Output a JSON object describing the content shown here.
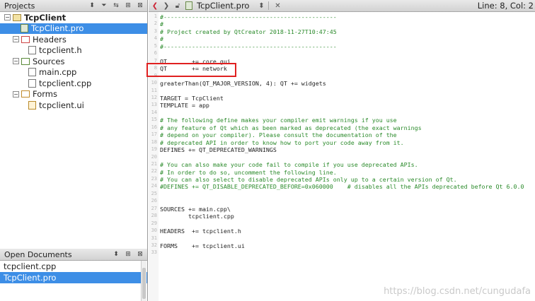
{
  "projects_panel": {
    "title": "Projects",
    "tree": [
      {
        "label": "TcpClient",
        "level": 0,
        "kind": "project",
        "expanded": true,
        "bold": true
      },
      {
        "label": "TcpClient.pro",
        "level": 1,
        "kind": "pro",
        "selected": true
      },
      {
        "label": "Headers",
        "level": 1,
        "kind": "folder-h",
        "expanded": true
      },
      {
        "label": "tcpclient.h",
        "level": 2,
        "kind": "h"
      },
      {
        "label": "Sources",
        "level": 1,
        "kind": "folder-s",
        "expanded": true
      },
      {
        "label": "main.cpp",
        "level": 2,
        "kind": "cpp"
      },
      {
        "label": "tcpclient.cpp",
        "level": 2,
        "kind": "cpp"
      },
      {
        "label": "Forms",
        "level": 1,
        "kind": "folder-f",
        "expanded": true
      },
      {
        "label": "tcpclient.ui",
        "level": 2,
        "kind": "ui"
      }
    ]
  },
  "open_documents": {
    "title": "Open Documents",
    "items": [
      {
        "label": "tcpclient.cpp",
        "selected": false
      },
      {
        "label": "TcpClient.pro",
        "selected": true
      }
    ]
  },
  "editor": {
    "filename": "TcpClient.pro",
    "line_info": "Line: 8, Col: 2",
    "lines": [
      {
        "n": "1",
        "text": "#-------------------------------------------------",
        "cls": "cm"
      },
      {
        "n": "2",
        "text": "#",
        "cls": "cm"
      },
      {
        "n": "3",
        "text": "# Project created by QtCreator 2018-11-27T10:47:45",
        "cls": "cm"
      },
      {
        "n": "4",
        "text": "#",
        "cls": "cm"
      },
      {
        "n": "5",
        "text": "#-------------------------------------------------",
        "cls": "cm"
      },
      {
        "n": "6",
        "text": "",
        "cls": "tx"
      },
      {
        "n": "7",
        "text": "QT       += core gui",
        "cls": "tx"
      },
      {
        "n": "8",
        "text": "QT       += network",
        "cls": "tx"
      },
      {
        "n": "9",
        "text": "",
        "cls": "tx"
      },
      {
        "n": "10",
        "text": "greaterThan(QT_MAJOR_VERSION, 4): QT += widgets",
        "cls": "tx"
      },
      {
        "n": "11",
        "text": "",
        "cls": "tx"
      },
      {
        "n": "12",
        "text": "TARGET = TcpClient",
        "cls": "tx"
      },
      {
        "n": "13",
        "text": "TEMPLATE = app",
        "cls": "tx"
      },
      {
        "n": "14",
        "text": "",
        "cls": "tx"
      },
      {
        "n": "15",
        "text": "# The following define makes your compiler emit warnings if you use",
        "cls": "cm"
      },
      {
        "n": "16",
        "text": "# any feature of Qt which as been marked as deprecated (the exact warnings",
        "cls": "cm"
      },
      {
        "n": "17",
        "text": "# depend on your compiler). Please consult the documentation of the",
        "cls": "cm"
      },
      {
        "n": "18",
        "text": "# deprecated API in order to know how to port your code away from it.",
        "cls": "cm"
      },
      {
        "n": "19",
        "text": "DEFINES += QT_DEPRECATED_WARNINGS",
        "cls": "tx"
      },
      {
        "n": "20",
        "text": "",
        "cls": "tx"
      },
      {
        "n": "21",
        "text": "# You can also make your code fail to compile if you use deprecated APIs.",
        "cls": "cm"
      },
      {
        "n": "22",
        "text": "# In order to do so, uncomment the following line.",
        "cls": "cm"
      },
      {
        "n": "23",
        "text": "# You can also select to disable deprecated APIs only up to a certain version of Qt.",
        "cls": "cm"
      },
      {
        "n": "24",
        "text": "#DEFINES += QT_DISABLE_DEPRECATED_BEFORE=0x060000    # disables all the APIs deprecated before Qt 6.0.0",
        "cls": "cm"
      },
      {
        "n": "25",
        "text": "",
        "cls": "tx"
      },
      {
        "n": "26",
        "text": "",
        "cls": "tx"
      },
      {
        "n": "27",
        "text": "SOURCES += main.cpp\\",
        "cls": "tx"
      },
      {
        "n": "28",
        "text": "        tcpclient.cpp",
        "cls": "tx"
      },
      {
        "n": "29",
        "text": "",
        "cls": "tx"
      },
      {
        "n": "30",
        "text": "HEADERS  += tcpclient.h",
        "cls": "tx"
      },
      {
        "n": "31",
        "text": "",
        "cls": "tx"
      },
      {
        "n": "32",
        "text": "FORMS    += tcpclient.ui",
        "cls": "tx"
      },
      {
        "n": "33",
        "text": "",
        "cls": "tx"
      }
    ]
  },
  "watermark": "https://blog.csdn.net/cungudafa",
  "colors": {
    "selection": "#3d8ee6",
    "comment": "#2a8a2a",
    "highlight_box": "#e02020"
  }
}
